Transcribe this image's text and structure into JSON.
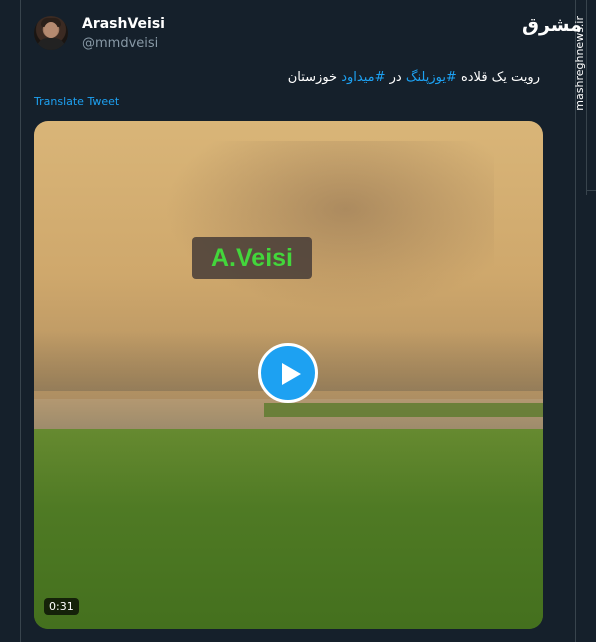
{
  "tweet": {
    "author_name": "ArashVeisi",
    "author_handle": "@mmdveisi",
    "text_part1": "رویت یک قلاده ",
    "hashtag1": "#یوزپلنگ",
    "text_part2": " در ",
    "hashtag2": "#میداود",
    "text_part3": " خوزستان",
    "translate_label": "Translate Tweet"
  },
  "video": {
    "overlay_label": "A.Veisi",
    "duration": "0:31"
  },
  "watermark": {
    "logo": "مشرق",
    "site": "mashreghnews.ir"
  },
  "colors": {
    "background": "#15202b",
    "link": "#1da1f2",
    "secondary_text": "#8899a6",
    "overlay_text": "#43d63b"
  }
}
